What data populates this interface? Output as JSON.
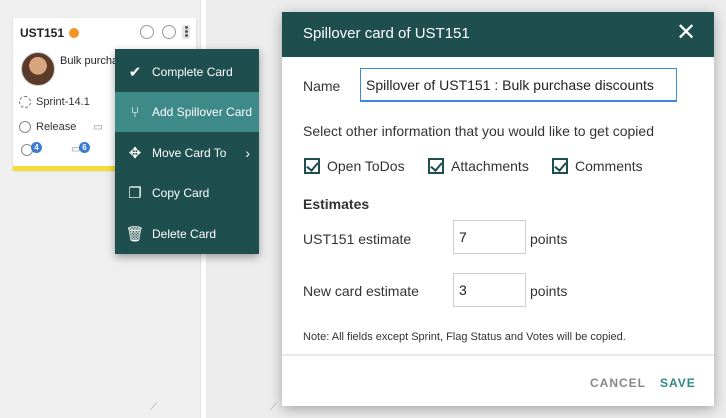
{
  "card": {
    "id": "UST151",
    "title": "Bulk purcha",
    "sprint": "Sprint-14.1",
    "release": "Release",
    "todo_count": "4",
    "comment_count": "6"
  },
  "menu": {
    "items": [
      {
        "label": "Complete Card",
        "icon": "check-circle-icon"
      },
      {
        "label": "Add Spillover Card",
        "icon": "split-arrow-icon"
      },
      {
        "label": "Move Card To",
        "icon": "move-arrows-icon"
      },
      {
        "label": "Copy Card",
        "icon": "copy-icon"
      },
      {
        "label": "Delete Card",
        "icon": "trash-icon"
      }
    ]
  },
  "dialog": {
    "title": "Spillover card of UST151",
    "name_label": "Name",
    "name_value": "Spillover of UST151 : Bulk purchase discounts",
    "copy_heading": "Select other information that you would like to get copied",
    "options": [
      {
        "label": "Open ToDos",
        "checked": true
      },
      {
        "label": "Attachments",
        "checked": true
      },
      {
        "label": "Comments",
        "checked": true
      }
    ],
    "estimates_heading": "Estimates",
    "current_estimate_label": "UST151 estimate",
    "current_estimate_value": "7",
    "new_estimate_label": "New card estimate",
    "new_estimate_value": "3",
    "points_label": "points",
    "note": "Note: All fields except Sprint, Flag Status and Votes will be copied.",
    "cancel_label": "CANCEL",
    "save_label": "SAVE"
  },
  "colors": {
    "header_bg": "#1f4e4f",
    "menu_active": "#3d8a88",
    "status_dot": "#f39425",
    "card_bar": "#f7dc3c",
    "save_text": "#2a8a86",
    "cancel_text": "#888888"
  }
}
